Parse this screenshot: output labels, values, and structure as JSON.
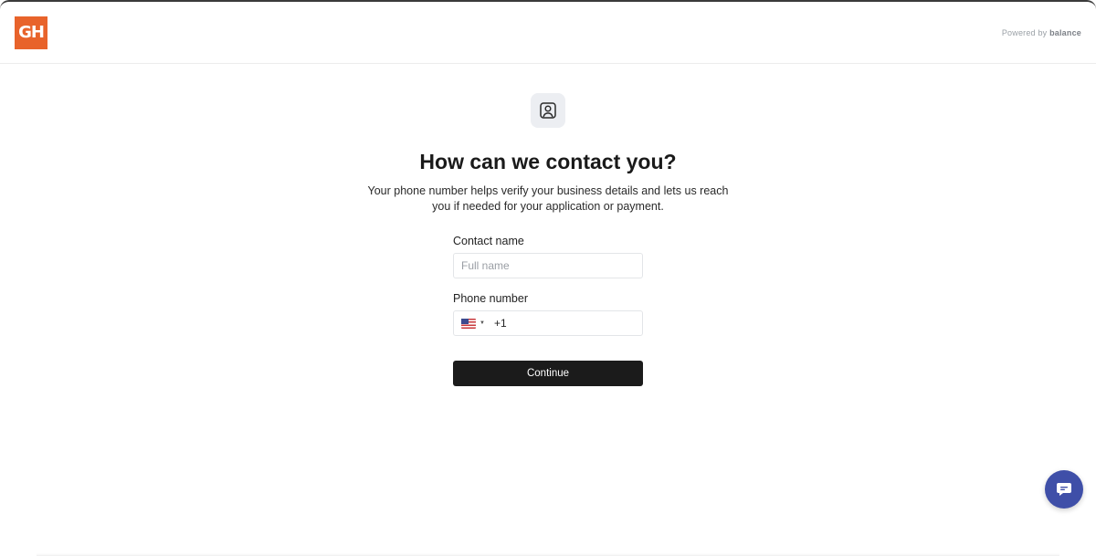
{
  "header": {
    "logo_text": "GH",
    "powered_prefix": "Powered by",
    "powered_brand": "balance"
  },
  "hero": {
    "icon": "contact-card-icon",
    "title": "How can we contact you?",
    "subtitle": "Your phone number helps verify your business details and lets us reach you if needed for your application or payment."
  },
  "form": {
    "contact_name": {
      "label": "Contact name",
      "value": "",
      "placeholder": "Full name"
    },
    "phone": {
      "label": "Phone number",
      "country_icon": "us-flag-icon",
      "value": "+1"
    },
    "continue_label": "Continue"
  },
  "chat": {
    "icon": "chat-bubble-icon"
  },
  "colors": {
    "logo_bg": "#e8632b",
    "button_bg": "#1b1b1b",
    "chat_bg": "#3f4fa8"
  }
}
